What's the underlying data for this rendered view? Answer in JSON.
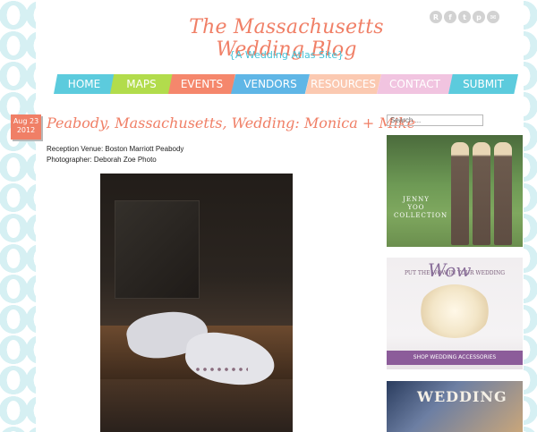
{
  "site": {
    "title": "The Massachusetts Wedding Blog",
    "tagline": "{A Wedding Atlas Site}"
  },
  "social_icons": [
    "rss-icon",
    "facebook-icon",
    "twitter-icon",
    "pinterest-icon",
    "email-icon"
  ],
  "nav": [
    {
      "label": "HOME",
      "color": "#5ccbdd"
    },
    {
      "label": "MAPS",
      "color": "#b2dc4c"
    },
    {
      "label": "EVENTS",
      "color": "#f5876c"
    },
    {
      "label": "VENDORS",
      "color": "#5fb6e6"
    },
    {
      "label": "RESOURCES",
      "color": "#fbc9b1"
    },
    {
      "label": "CONTACT",
      "color": "#f1c4e0"
    },
    {
      "label": "SUBMIT",
      "color": "#5ccbdd"
    }
  ],
  "post": {
    "date_month_day": "Aug 23",
    "date_year": "2012",
    "title": "Peabody, Massachusetts, Wedding: Monica + Mike",
    "venue": "Reception Venue: Boston Marriott Peabody",
    "photographer": "Photographer: Deborah Zoe Photo"
  },
  "sidebar": {
    "search_placeholder": "Search ...",
    "ad1_text": "JENNY YOO COLLECTION",
    "ad2_header": "PUT THE WOW IN YOUR WEDDING",
    "ad2_wow": "Wow",
    "ad2_bar": "SHOP WEDDING ACCESSORIES",
    "ad3_text": "WEDDING"
  }
}
